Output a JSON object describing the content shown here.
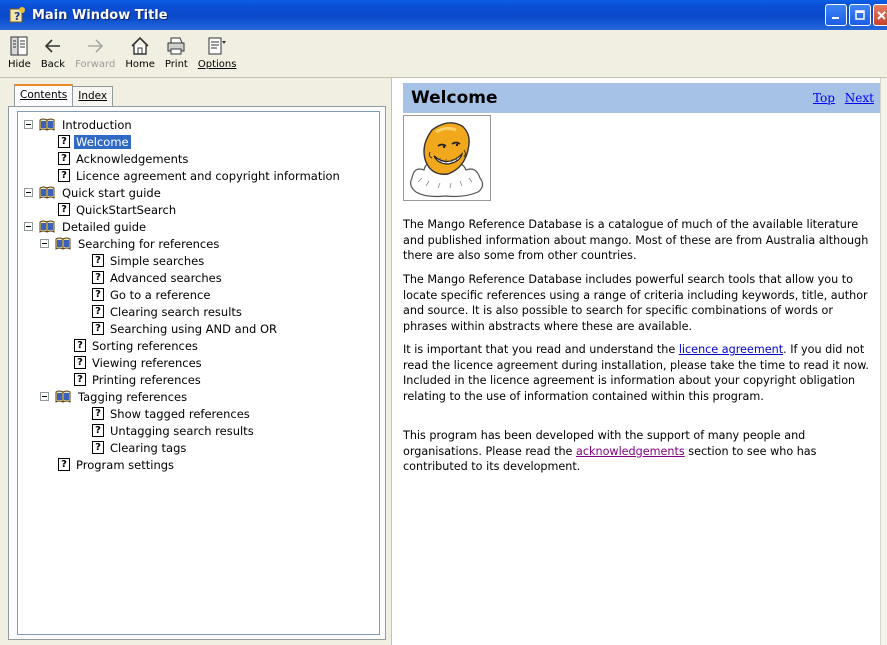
{
  "window": {
    "title": "Main Window Title"
  },
  "toolbar": {
    "hide": "Hide",
    "back": "Back",
    "forward": "Forward",
    "home": "Home",
    "print": "Print",
    "options": "Options"
  },
  "tabs": {
    "contents": "Contents",
    "index": "Index"
  },
  "tree": {
    "introduction": "Introduction",
    "welcome": "Welcome",
    "acknowledgements": "Acknowledgements",
    "licence": "Licence agreement and copyright information",
    "quick_start": "Quick start guide",
    "quick_start_search": "QuickStartSearch",
    "detailed_guide": "Detailed guide",
    "searching": "Searching for references",
    "simple_searches": "Simple searches",
    "advanced_searches": "Advanced searches",
    "go_to_reference": "Go to a reference",
    "clearing_search": "Clearing search results",
    "searching_and_or": "Searching using AND and OR",
    "sorting": "Sorting references",
    "viewing": "Viewing references",
    "printing": "Printing references",
    "tagging": "Tagging references",
    "show_tagged": "Show tagged references",
    "untagging": "Untagging search results",
    "clearing_tags": "Clearing tags",
    "program_settings": "Program settings"
  },
  "content": {
    "title": "Welcome",
    "top_link": "Top",
    "next_link": "Next",
    "p1": "The Mango Reference Database is a catalogue of much of the available literature and published information about mango.  Most of these are from Australia although there are also some from other countries.",
    "p2": "The Mango Reference Database includes powerful search tools that allow you to locate specific references using a range of criteria including keywords, title, author and source.  It is also possible to search for specific combinations of words or phrases within abstracts where these are available.",
    "p3_before": "It is important that you read and understand the ",
    "p3_link": "licence agreement",
    "p3_after": ".  If you did not read the licence agreement during installation, please take the time to read it now.  Included in the licence agreement is information about your copyright obligation relating to the use of information contained within this program.",
    "p4_before": "This program has been developed with the support of many people and organisations.  Please read the ",
    "p4_link": "acknowledgements",
    "p4_after": " section to see who has contributed to its development."
  },
  "colors": {
    "titlebar": "#0a4fd5",
    "header_band": "#a6c2e6",
    "selection": "#316ac5",
    "link": "#0000cc",
    "visited_link": "#800080"
  }
}
